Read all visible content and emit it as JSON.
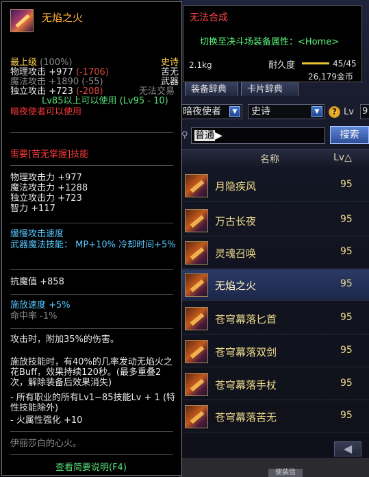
{
  "tooltip": {
    "item_name": "无焰之火",
    "grade": "最上级",
    "grade_pct": "(100%)",
    "rarity": "史诗",
    "category": "苦无",
    "type": "武器",
    "trade": "无法交易",
    "physical_attack": "物理攻击 +977",
    "physical_attack_diff": "(-1706)",
    "magic_attack": "魔法攻击 +1890",
    "magic_attack_diff": "(-55)",
    "independent_attack": "独立攻击 +723",
    "independent_attack_diff": "(-208)",
    "level_requirement": "Lv85以上可以使用 (Lv95 - 10)",
    "job_requirement": "暗夜使者可以使用",
    "skill_requirement": "需要[苦无掌握]技能",
    "stats": [
      "物理攻击力 +977",
      "魔法攻击力 +1288",
      "独立攻击力 +723",
      "智力 +117"
    ],
    "attack_speed": "缓慢攻击速度",
    "skill_effect": "武器魔法技能： MP+10% 冷却时间+5%",
    "magic_resist": "抗魔值 +858",
    "cast_speed": "施放速度 +5%",
    "hit_rate": "命中率 -1%",
    "extra_damage": "攻击时，附加35%的伤害。",
    "buff_desc": "施放技能时，有40%的几率发动无焰火之花Buff，效果持续120秒。(最多重叠2次，解除装备后效果消失)",
    "skill_bonus": "- 所有职业的所有Lv1~85技能Lv + 1 (特性技能除外)",
    "fire_bonus": "- 火属性强化 +10",
    "flavor": "伊丽莎白的心火。",
    "bottom_button": "查看简要说明(F4)"
  },
  "popup": {
    "title": "无法合成",
    "switch_text": "切换至决斗场装备属性：<Home>",
    "weight": "2.1kg",
    "durability_label": "耐久度",
    "durability": "45/45",
    "durability_fraction": 1.0,
    "gold": "26,179金币"
  },
  "dictionary": {
    "tabs": [
      "装备辞典",
      "卡片辞典"
    ],
    "job_select": "暗夜使者",
    "grade_select": "史诗",
    "lv_label": "Lv",
    "lv_value": "9",
    "search_value": "普通",
    "search_button": "搜索",
    "col_name": "名称",
    "col_lv": "Lv△",
    "rows": [
      {
        "name": "月隐疾风",
        "lv": "95"
      },
      {
        "name": "万古长夜",
        "lv": "95"
      },
      {
        "name": "灵魂召唤",
        "lv": "95"
      },
      {
        "name": "无焰之火",
        "lv": "95"
      },
      {
        "name": "苍穹幕落匕首",
        "lv": "95"
      },
      {
        "name": "苍穹幕落双剑",
        "lv": "95"
      },
      {
        "name": "苍穹幕落手杖",
        "lv": "95"
      },
      {
        "name": "苍穹幕落苦无",
        "lv": "95"
      }
    ],
    "selected_row": 3,
    "bottom_tab": "便装信"
  },
  "colors": {
    "item_name": "#ffb13b",
    "red_diff": "#e0463c",
    "green_text": "#58e07a",
    "cyan_text": "#58c8ff",
    "selected_row": "#2b3a66"
  }
}
